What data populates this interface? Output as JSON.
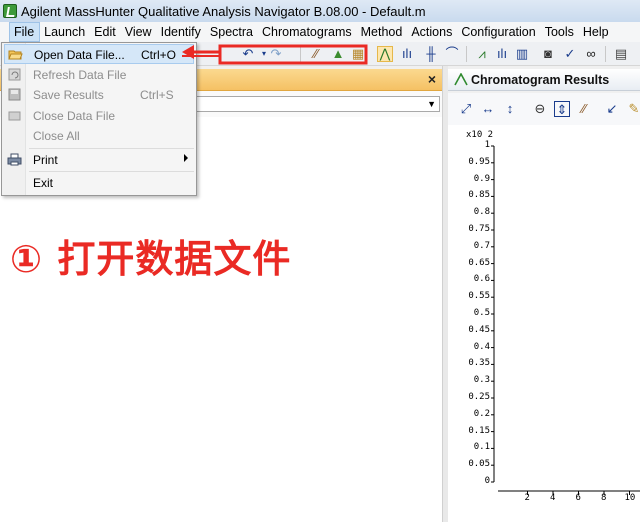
{
  "window": {
    "title": "Agilent MassHunter Qualitative Analysis Navigator B.08.00 - Default.m"
  },
  "menubar": {
    "items": [
      "File",
      "Launch",
      "Edit",
      "View",
      "Identify",
      "Spectra",
      "Chromatograms",
      "Method",
      "Actions",
      "Configuration",
      "Tools",
      "Help"
    ]
  },
  "file_menu": {
    "open": {
      "label": "Open Data File...",
      "shortcut": "Ctrl+O"
    },
    "refresh": {
      "label": "Refresh Data File"
    },
    "save": {
      "label": "Save Results",
      "shortcut": "Ctrl+S"
    },
    "close_file": {
      "label": "Close Data File"
    },
    "close_all": {
      "label": "Close All"
    },
    "print": {
      "label": "Print"
    },
    "exit": {
      "label": "Exit"
    }
  },
  "left_panel": {
    "close_glyph": "×"
  },
  "right_panel": {
    "title": "Chromatogram Results",
    "chart": {
      "y_exponent": "x10 2",
      "y_ticks": [
        "1",
        "0.95",
        "0.9",
        "0.85",
        "0.8",
        "0.75",
        "0.7",
        "0.65",
        "0.6",
        "0.55",
        "0.5",
        "0.45",
        "0.4",
        "0.35",
        "0.3",
        "0.25",
        "0.2",
        "0.15",
        "0.1",
        "0.05",
        "0"
      ],
      "x_ticks": [
        "2",
        "4",
        "6",
        "8",
        "10"
      ]
    }
  },
  "annotation": {
    "text": "① 打开数据文件",
    "color": "#ea2a24"
  },
  "colors": {
    "accent_orange": "#f5c164",
    "highlight_blue": "#d5e7f8",
    "annotation_red": "#ea2a24"
  }
}
